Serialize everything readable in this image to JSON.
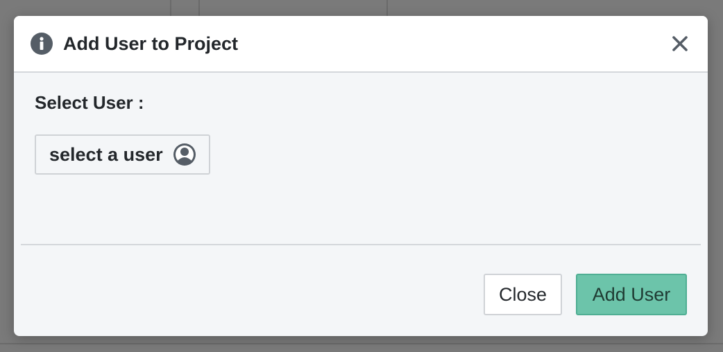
{
  "modal": {
    "title": "Add User to Project",
    "select_label": "Select User :",
    "user_select": {
      "label": "select a user"
    },
    "footer": {
      "close_label": "Close",
      "add_label": "Add User"
    }
  },
  "colors": {
    "primary": "#6cc4aa",
    "overlay": "#7a7a7a",
    "modal_bg": "#f4f6f8"
  },
  "icons": {
    "header": "info-icon",
    "close": "close-icon",
    "user": "user-icon"
  }
}
